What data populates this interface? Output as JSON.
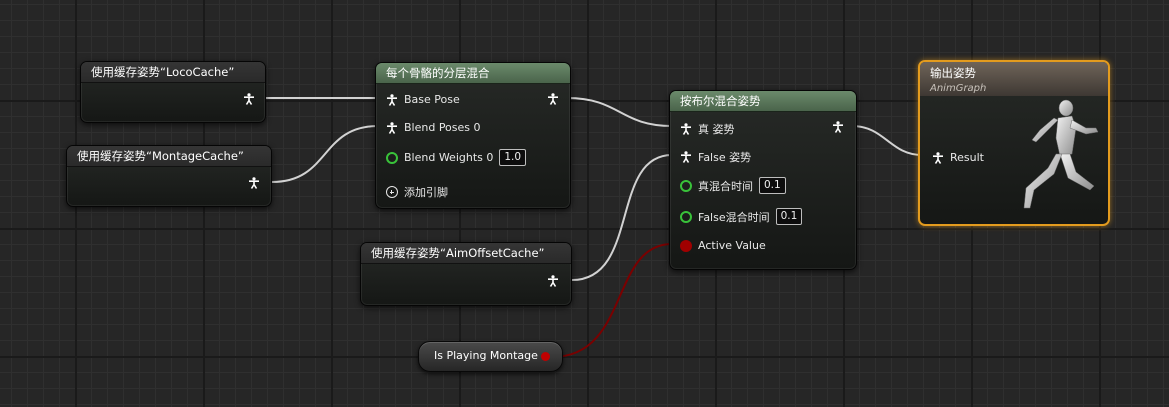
{
  "graph": {
    "cache_loco": {
      "title": "使用缓存姿势“LocoCache”"
    },
    "cache_montage": {
      "title": "使用缓存姿势“MontageCache”"
    },
    "cache_aim": {
      "title": "使用缓存姿势“AimOffsetCache”"
    },
    "layered_blend": {
      "title": "每个骨骼的分层混合",
      "pins": {
        "base_pose": "Base Pose",
        "blend_poses": "Blend Poses 0",
        "blend_weights": "Blend Weights 0",
        "add_pin": "添加引脚"
      },
      "blend_weights_value": "1.0"
    },
    "bool_blend": {
      "title": "按布尔混合姿势",
      "pins": {
        "true_pose": "真 姿势",
        "false_pose": "False 姿势",
        "true_blend_time": "真混合时间",
        "false_blend_time": "False混合时间",
        "active_value": "Active Value"
      },
      "true_blend_time_value": "0.1",
      "false_blend_time_value": "0.1"
    },
    "output_pose": {
      "title": "输出姿势",
      "subtitle": "AnimGraph",
      "result": "Result"
    },
    "variable": {
      "label": "Is Playing Montage"
    }
  },
  "colors": {
    "pose_wire": "#d0d0d0",
    "bool_wire": "#8a0000",
    "float_pin": "#39c23a",
    "bool_pin": "#a00000",
    "node_header_green": "#5a765a",
    "result_border": "#e39b1e"
  }
}
